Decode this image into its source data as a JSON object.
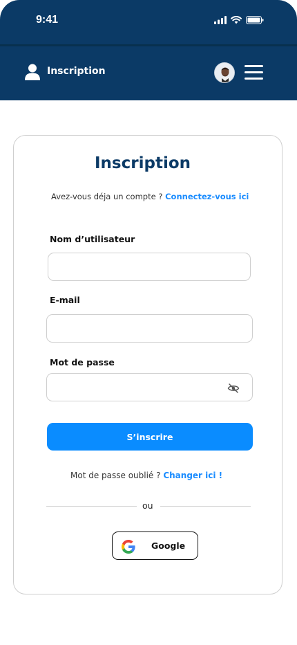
{
  "status_bar": {
    "time": "9:41"
  },
  "header": {
    "title": "Inscription"
  },
  "card": {
    "title": "Inscription",
    "login_prompt": "Avez-vous déja un compte ?",
    "login_link": "Connectez-vous ici",
    "fields": {
      "username_label": "Nom d’utilisateur",
      "username_value": "",
      "email_label": "E-mail",
      "email_value": "",
      "password_label": "Mot de passe",
      "password_value": ""
    },
    "submit_label": "S’inscrire",
    "forgot_prompt": "Mot de passe oublié ?",
    "forgot_link": "Changer ici !",
    "divider_text": "ou",
    "google_label": "Google"
  },
  "colors": {
    "header_bg": "#0b3a66",
    "primary": "#0a8cff",
    "link": "#1a8cff",
    "title": "#0b3a66"
  }
}
